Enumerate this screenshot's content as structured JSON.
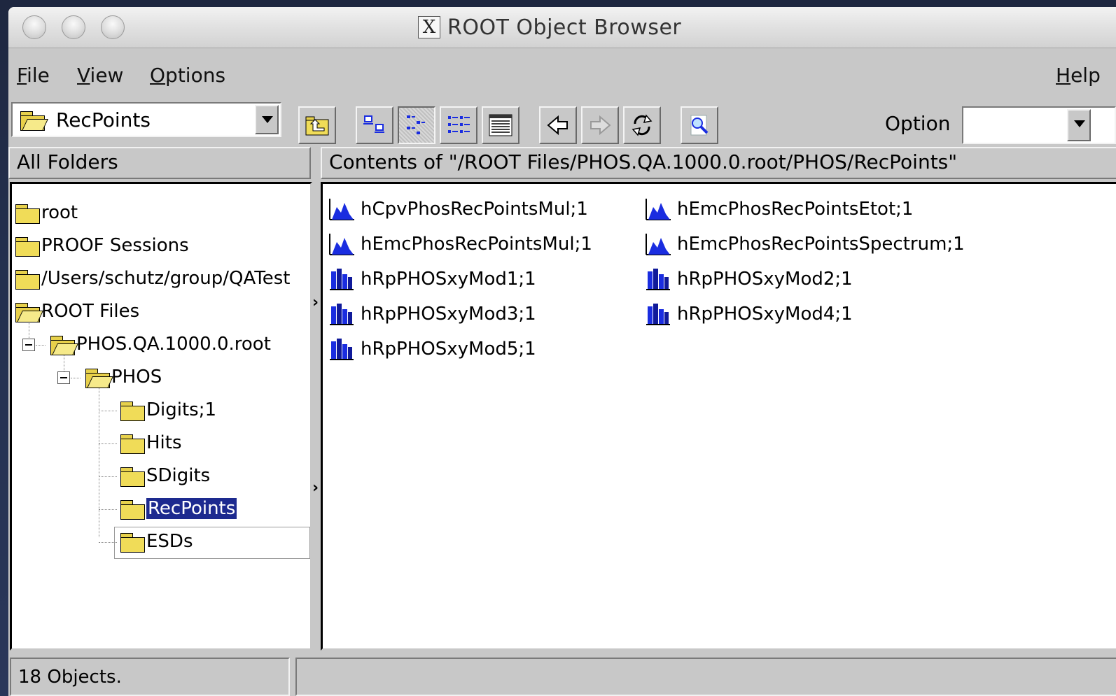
{
  "window": {
    "title": "ROOT Object Browser"
  },
  "menu": [
    {
      "label": "File",
      "mnemonic": "F",
      "rest": "ile"
    },
    {
      "label": "View",
      "mnemonic": "V",
      "rest": "iew"
    },
    {
      "label": "Options",
      "mnemonic": "O",
      "rest": "ptions"
    }
  ],
  "help": {
    "label": "Help",
    "mnemonic": "H",
    "rest": "elp"
  },
  "toolbar": {
    "location_value": "RecPoints",
    "option_label": "Option",
    "option_value": ""
  },
  "panes": {
    "left_header": "All Folders",
    "right_header": "Contents of \"/ROOT Files/PHOS.QA.1000.0.root/PHOS/RecPoints\""
  },
  "tree": [
    {
      "label": "root"
    },
    {
      "label": "PROOF Sessions"
    },
    {
      "label": "/Users/schutz/group/QATest"
    },
    {
      "label": "ROOT Files"
    },
    {
      "label": "PHOS.QA.1000.0.root"
    },
    {
      "label": "PHOS"
    },
    {
      "label": "Digits;1"
    },
    {
      "label": "Hits"
    },
    {
      "label": "SDigits"
    },
    {
      "label": "RecPoints",
      "selected": true
    },
    {
      "label": "ESDs"
    }
  ],
  "contents": [
    {
      "label": "hCpvPhosRecPointsMul;1",
      "icon": "histogram-1d-icon"
    },
    {
      "label": "hEmcPhosRecPointsEtot;1",
      "icon": "histogram-1d-icon"
    },
    {
      "label": "hEmcPhosRecPointsMul;1",
      "icon": "histogram-1d-icon"
    },
    {
      "label": "hEmcPhosRecPointsSpectrum;1",
      "icon": "histogram-1d-icon"
    },
    {
      "label": "hRpPHOSxyMod1;1",
      "icon": "histogram-2d-icon"
    },
    {
      "label": "hRpPHOSxyMod2;1",
      "icon": "histogram-2d-icon"
    },
    {
      "label": "hRpPHOSxyMod3;1",
      "icon": "histogram-2d-icon"
    },
    {
      "label": "hRpPHOSxyMod4;1",
      "icon": "histogram-2d-icon"
    },
    {
      "label": "hRpPHOSxyMod5;1",
      "icon": "histogram-2d-icon"
    }
  ],
  "status": {
    "objects": "18 Objects."
  },
  "colors": {
    "selection": "#1d2a8f",
    "folder": "#f0dc58",
    "histogram": "#1a2de0"
  }
}
